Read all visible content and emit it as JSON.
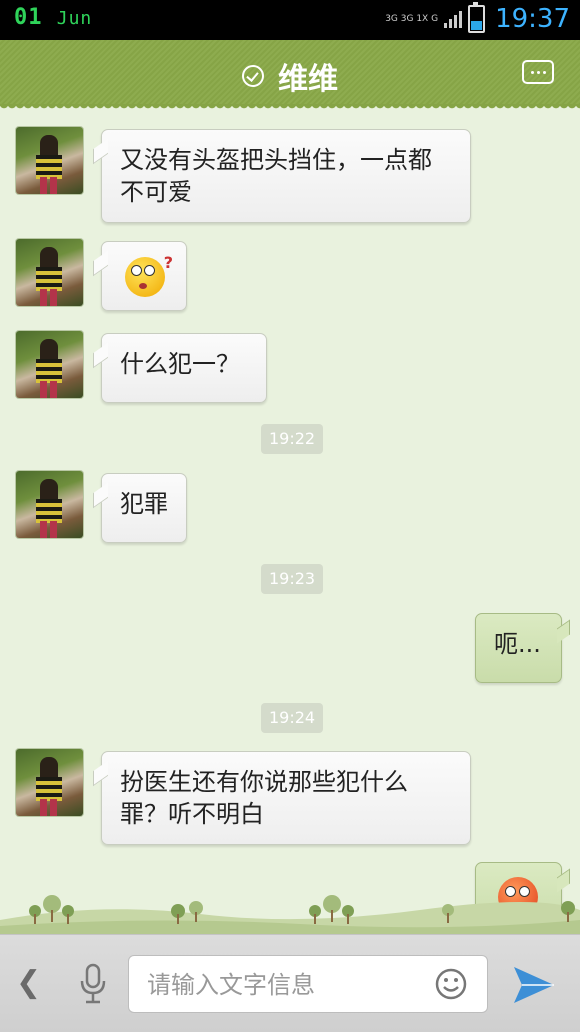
{
  "status_bar": {
    "day": "01",
    "month": "Jun",
    "network_top": "3G 3G 1X G",
    "time": "19:37"
  },
  "header": {
    "title": "维维"
  },
  "messages": [
    {
      "side": "left",
      "kind": "text",
      "text": "又没有头盔把头挡住，一点都不可爱"
    },
    {
      "side": "left",
      "kind": "emoji",
      "emoji": "confused-face-emoji"
    },
    {
      "side": "left",
      "kind": "text",
      "text": "什么犯一？"
    },
    {
      "kind": "time",
      "text": "19:22"
    },
    {
      "side": "left",
      "kind": "text",
      "text": "犯罪"
    },
    {
      "kind": "time",
      "text": "19:23"
    },
    {
      "side": "right",
      "kind": "text",
      "text": "呃..."
    },
    {
      "kind": "time",
      "text": "19:24"
    },
    {
      "side": "left",
      "kind": "text",
      "text": "扮医生还有你说那些犯什么罪？听不明白"
    },
    {
      "side": "right",
      "kind": "emoji",
      "emoji": "rolling-eyes-emoji"
    }
  ],
  "input_bar": {
    "placeholder": "请输入文字信息"
  },
  "colors": {
    "header_green": "#8aa84a",
    "chat_background": "#e9f2de",
    "time_accent": "#3db3ff",
    "send_blue": "#3d8fd6"
  }
}
